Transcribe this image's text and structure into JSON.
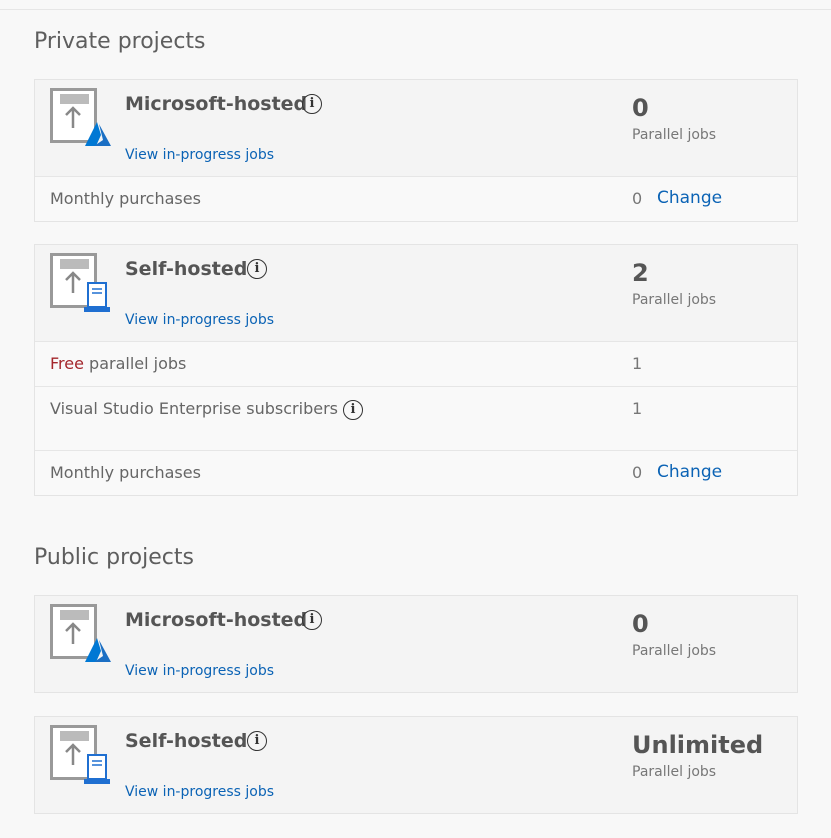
{
  "sections": [
    {
      "title": "Private projects"
    },
    {
      "title": "Public projects"
    }
  ],
  "private": {
    "microsoft": {
      "title": "Microsoft-hosted",
      "link": "View in-progress jobs",
      "count": "0",
      "count_label": "Parallel jobs",
      "rows": [
        {
          "label": "Monthly purchases",
          "value": "0",
          "action": "Change"
        }
      ]
    },
    "self": {
      "title": "Self-hosted",
      "link": "View in-progress jobs",
      "count": "2",
      "count_label": "Parallel jobs",
      "rows": [
        {
          "label_prefix": "Free",
          "label": " parallel jobs",
          "value": "1"
        },
        {
          "label": "Visual Studio Enterprise subscribers",
          "value": "1"
        },
        {
          "label": "Monthly purchases",
          "value": "0",
          "action": "Change"
        }
      ]
    }
  },
  "public": {
    "microsoft": {
      "title": "Microsoft-hosted",
      "link": "View in-progress jobs",
      "count": "0",
      "count_label": "Parallel jobs"
    },
    "self": {
      "title": "Self-hosted",
      "link": "View in-progress jobs",
      "count": "Unlimited",
      "count_label": "Parallel jobs"
    }
  },
  "icons": {
    "info": "i",
    "agent_cloud": "azure-agent-icon",
    "agent_server": "self-hosted-agent-icon"
  },
  "colors": {
    "link": "#0b63b5",
    "free": "#a4262c",
    "azure": "#0078d4"
  }
}
